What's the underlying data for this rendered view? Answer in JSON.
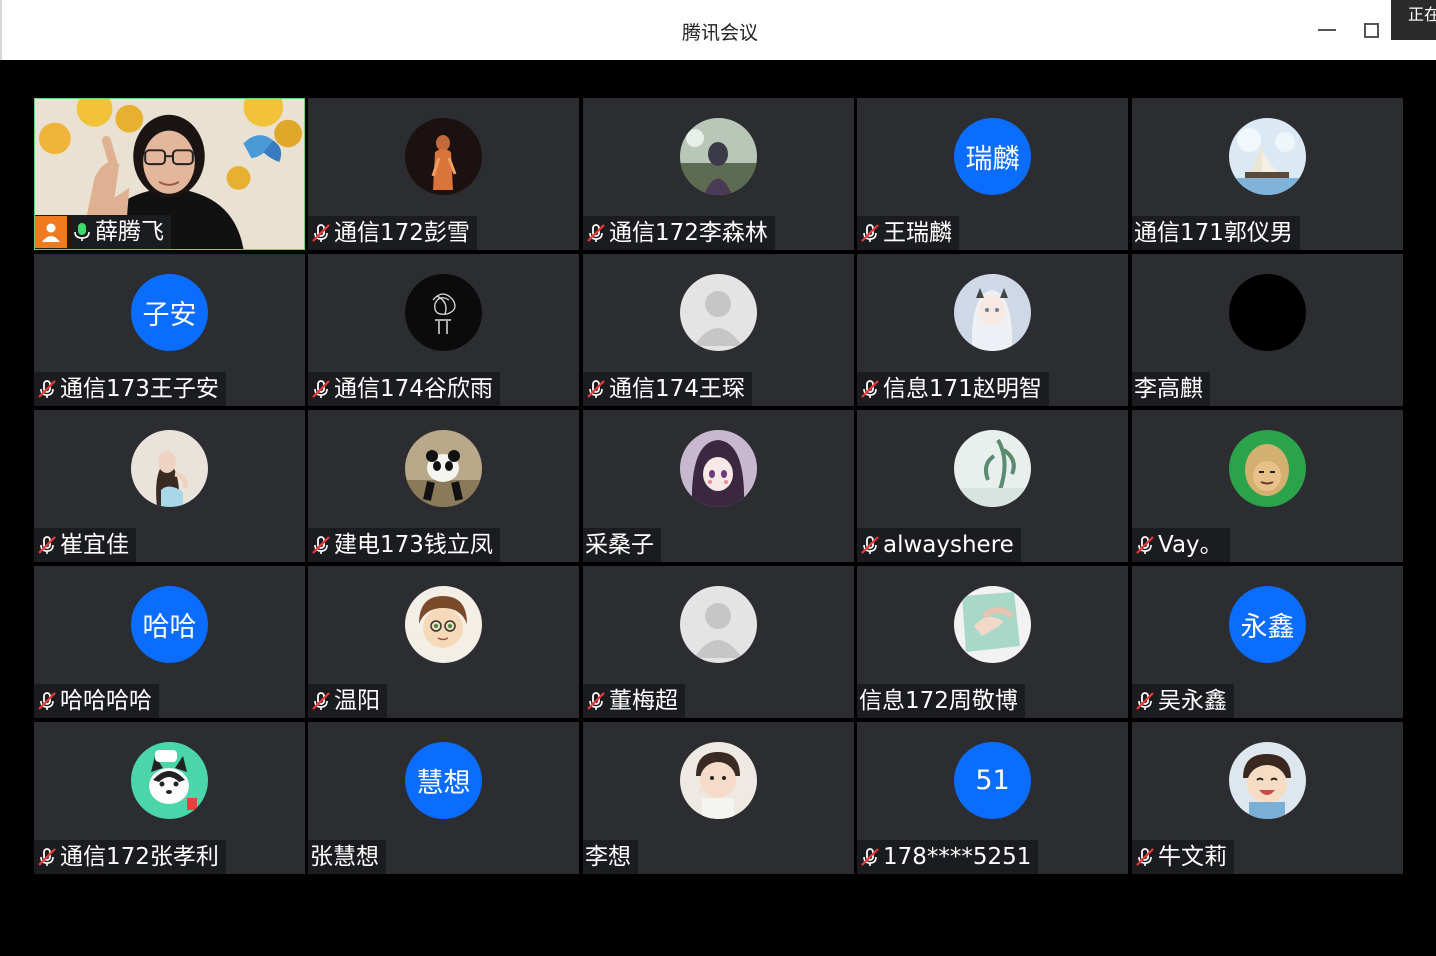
{
  "window": {
    "title": "腾讯会议",
    "corner_tag": "正在"
  },
  "participants": [
    {
      "name": "薛腾飞",
      "mic": "on",
      "host": true,
      "avatar": "camera-video"
    },
    {
      "name": "通信172彭雪",
      "mic": "muted",
      "avatar": "photo-dark-figure"
    },
    {
      "name": "通信172李森林",
      "mic": "muted",
      "avatar": "photo-landscape"
    },
    {
      "name": "王瑞麟",
      "mic": "muted",
      "avatar_text": "瑞麟"
    },
    {
      "name": "通信171郭仪男",
      "mic": "none",
      "avatar": "photo-sailboat"
    },
    {
      "name": "通信173王子安",
      "mic": "muted",
      "avatar_text": "子安"
    },
    {
      "name": "通信174谷欣雨",
      "mic": "muted",
      "avatar": "photo-scribble"
    },
    {
      "name": "通信174王琛",
      "mic": "muted",
      "avatar": "default-person"
    },
    {
      "name": "信息171赵明智",
      "mic": "muted",
      "avatar": "photo-anime-girl"
    },
    {
      "name": "李高麒",
      "mic": "none",
      "avatar": "black-circle"
    },
    {
      "name": "崔宜佳",
      "mic": "muted",
      "avatar": "photo-girl"
    },
    {
      "name": "建电173钱立凤",
      "mic": "muted",
      "avatar": "photo-panda"
    },
    {
      "name": "采桑子",
      "mic": "none",
      "avatar": "photo-anime-purple"
    },
    {
      "name": "alwayshere",
      "mic": "muted",
      "avatar": "photo-plant"
    },
    {
      "name": "Vay。",
      "mic": "muted",
      "avatar": "photo-meme-face"
    },
    {
      "name": "哈哈哈哈",
      "mic": "muted",
      "avatar_text": "哈哈"
    },
    {
      "name": "温阳",
      "mic": "muted",
      "avatar": "photo-cartoon-boy"
    },
    {
      "name": "董梅超",
      "mic": "muted",
      "avatar": "default-person"
    },
    {
      "name": "信息172周敬博",
      "mic": "none",
      "avatar": "photo-hands"
    },
    {
      "name": "吴永鑫",
      "mic": "muted",
      "avatar_text": "永鑫"
    },
    {
      "name": "通信172张孝利",
      "mic": "muted",
      "avatar": "photo-husky"
    },
    {
      "name": "张慧想",
      "mic": "none",
      "avatar_text": "慧想"
    },
    {
      "name": "李想",
      "mic": "none",
      "avatar": "photo-baby"
    },
    {
      "name": "178****5251",
      "mic": "muted",
      "avatar_text": "51"
    },
    {
      "name": "牛文莉",
      "mic": "muted",
      "avatar": "photo-child"
    }
  ],
  "colors": {
    "avatar_blue": "#0a6dff",
    "tile_bg": "#2b2d31",
    "host_badge": "#f07a20",
    "active_border": "#6ad26a"
  }
}
